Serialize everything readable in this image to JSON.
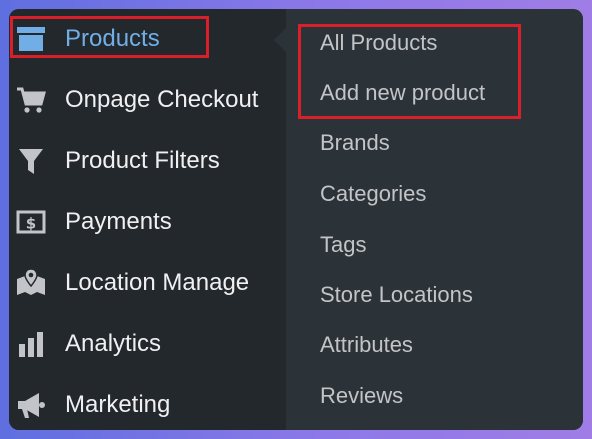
{
  "main_menu": {
    "items": [
      {
        "label": "Products",
        "icon": "archive-box-icon",
        "active": true
      },
      {
        "label": "Onpage Checkout",
        "icon": "cart-icon"
      },
      {
        "label": "Product Filters",
        "icon": "filter-funnel-icon"
      },
      {
        "label": "Payments",
        "icon": "money-bill-icon"
      },
      {
        "label": "Location Manage",
        "icon": "map-location-icon"
      },
      {
        "label": "Analytics",
        "icon": "bar-chart-icon"
      },
      {
        "label": "Marketing",
        "icon": "megaphone-icon"
      }
    ]
  },
  "submenu": {
    "items": [
      {
        "label": "All Products"
      },
      {
        "label": "Add new product"
      },
      {
        "label": "Brands"
      },
      {
        "label": "Categories"
      },
      {
        "label": "Tags"
      },
      {
        "label": "Store Locations"
      },
      {
        "label": "Attributes"
      },
      {
        "label": "Reviews"
      }
    ]
  },
  "colors": {
    "menu_bg": "#23282d",
    "submenu_bg": "#2c3338",
    "active_text": "#72aee6",
    "menu_text": "#f0f0f1",
    "submenu_text": "#c3c4c7",
    "highlight": "#d81f2a"
  }
}
